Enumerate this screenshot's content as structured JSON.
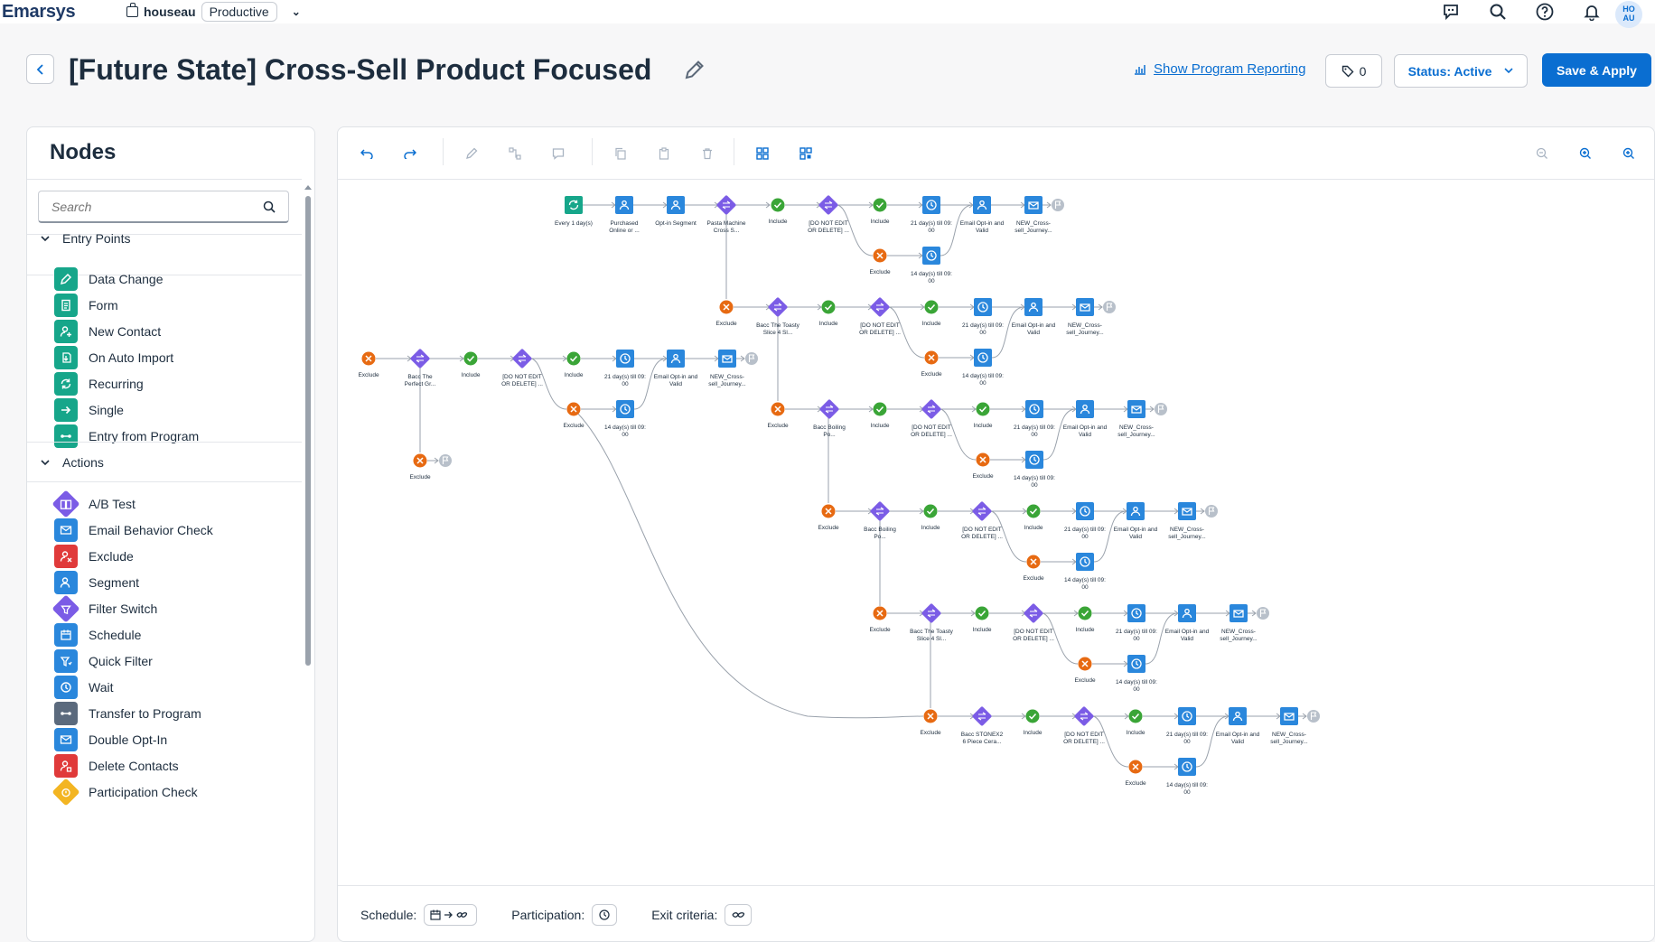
{
  "app": {
    "brand": "Emarsys",
    "tenant": "houseau",
    "environment": "Productive",
    "avatar_initials_1": "HO",
    "avatar_initials_2": "AU"
  },
  "header": {
    "title": "[Future State] Cross-Sell Product Focused",
    "reporting_link": "Show Program Reporting",
    "tag_count": "0",
    "status_label": "Status: Active",
    "save_label": "Save & Apply"
  },
  "nodes_panel": {
    "title": "Nodes",
    "search_placeholder": "Search",
    "sections": [
      {
        "label": "Entry Points",
        "items": [
          {
            "label": "Data Change",
            "icon": "data-change-icon",
            "color": "#16a68a"
          },
          {
            "label": "Form",
            "icon": "form-icon",
            "color": "#16a68a"
          },
          {
            "label": "New Contact",
            "icon": "new-contact-icon",
            "color": "#16a68a"
          },
          {
            "label": "On Auto Import",
            "icon": "auto-import-icon",
            "color": "#16a68a"
          },
          {
            "label": "Recurring",
            "icon": "recurring-icon",
            "color": "#16a68a"
          },
          {
            "label": "Single",
            "icon": "single-icon",
            "color": "#16a68a"
          },
          {
            "label": "Entry from Program",
            "icon": "entry-from-program-icon",
            "color": "#16a68a"
          }
        ]
      },
      {
        "label": "Actions",
        "items": [
          {
            "label": "A/B Test",
            "icon": "ab-test-icon",
            "color": "#7b5ce6"
          },
          {
            "label": "Email Behavior Check",
            "icon": "email-behavior-icon",
            "color": "#2a87dc"
          },
          {
            "label": "Exclude",
            "icon": "exclude-icon",
            "color": "#e03a3a"
          },
          {
            "label": "Segment",
            "icon": "segment-icon",
            "color": "#2a87dc"
          },
          {
            "label": "Filter Switch",
            "icon": "filter-switch-icon",
            "color": "#7b5ce6"
          },
          {
            "label": "Schedule",
            "icon": "schedule-icon",
            "color": "#2a87dc"
          },
          {
            "label": "Quick Filter",
            "icon": "quick-filter-icon",
            "color": "#2a87dc"
          },
          {
            "label": "Wait",
            "icon": "wait-icon",
            "color": "#2a87dc"
          },
          {
            "label": "Transfer to Program",
            "icon": "transfer-icon",
            "color": "#5b6a7d"
          },
          {
            "label": "Double Opt-In",
            "icon": "double-opt-in-icon",
            "color": "#2a87dc"
          },
          {
            "label": "Delete Contacts",
            "icon": "delete-contacts-icon",
            "color": "#e03a3a"
          },
          {
            "label": "Participation Check",
            "icon": "participation-check-icon",
            "color": "#f3b522"
          }
        ]
      }
    ]
  },
  "canvas_labels": {
    "entry": "Every 1 day(s)",
    "purchased": [
      "Purchased",
      "Online or ..."
    ],
    "optin_segment": "Opt-in Segment",
    "include": "Include",
    "exclude": "Exclude",
    "do_not_edit": [
      "[DO NOT EDIT",
      "OR DELETE] ..."
    ],
    "wait21": [
      "21 day(s) till 09:",
      "00"
    ],
    "wait14": [
      "14 day(s) till 09:",
      "00"
    ],
    "email_optin": [
      "Email Opt-in and",
      "Valid"
    ],
    "new_cross": [
      "NEW_Cross-",
      "sell_Journey..."
    ],
    "branches": [
      [
        "Pasta Machine",
        "Cross S..."
      ],
      [
        "Bacc The Toasty",
        "Slice 4 Sl..."
      ],
      [
        "Bacc The",
        "Perfect Gr..."
      ],
      [
        "Bacc Boiling",
        "Po..."
      ],
      [
        "Bacc Boiling",
        "Po..."
      ],
      [
        "Bacc The Toasty",
        "Slice 4 Sl..."
      ],
      [
        "Bacc STONEX2",
        "6 Piece Cera..."
      ]
    ]
  },
  "footer": {
    "schedule_label": "Schedule:",
    "participation_label": "Participation:",
    "exit_label": "Exit criteria:"
  },
  "colors": {
    "primary": "#0a6ed1",
    "node_blue": "#2a87dc",
    "node_purple": "#7b5ce6",
    "include_green": "#3aa537",
    "exclude_orange": "#e76a12",
    "entry_teal": "#16a68a"
  }
}
